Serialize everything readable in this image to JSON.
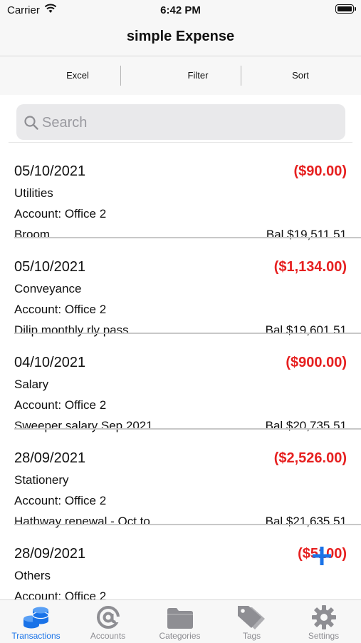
{
  "status_bar": {
    "carrier": "Carrier",
    "time": "6:42 PM"
  },
  "nav": {
    "title": "simple Expense"
  },
  "toolbar": {
    "excel": "Excel",
    "filter": "Filter",
    "sort": "Sort"
  },
  "search": {
    "placeholder": "Search"
  },
  "transactions": [
    {
      "date": "05/10/2021",
      "amount": "($90.00)",
      "category": "Utilities",
      "account": "Account: Office 2",
      "memo": "Broom",
      "balance": "Bal.$19,511.51"
    },
    {
      "date": "05/10/2021",
      "amount": "($1,134.00)",
      "category": "Conveyance",
      "account": "Account: Office 2",
      "memo": "Dilip monthly rly pass",
      "balance": "Bal.$19,601.51"
    },
    {
      "date": "04/10/2021",
      "amount": "($900.00)",
      "category": "Salary",
      "account": "Account: Office 2",
      "memo": "Sweeper salary Sep 2021",
      "balance": "Bal.$20,735.51"
    },
    {
      "date": "28/09/2021",
      "amount": "($2,526.00)",
      "category": "Stationery",
      "account": "Account: Office 2",
      "memo": "Hathway renewal - Oct to",
      "balance": "Bal.$21,635.51"
    },
    {
      "date": "28/09/2021",
      "amount": "($5100)",
      "category": "Others",
      "account": "Account: Office 2",
      "memo": "",
      "balance": ""
    }
  ],
  "tabs": [
    {
      "label": "Transactions",
      "icon": "coins-stack-icon",
      "active": true
    },
    {
      "label": "Accounts",
      "icon": "at-sign-icon",
      "active": false
    },
    {
      "label": "Categories",
      "icon": "folder-icon",
      "active": false
    },
    {
      "label": "Tags",
      "icon": "tags-icon",
      "active": false
    },
    {
      "label": "Settings",
      "icon": "gear-icon",
      "active": false
    }
  ],
  "colors": {
    "accent": "#1a73e8",
    "expense": "#e62020",
    "bar_bg": "#f7f7f7"
  }
}
